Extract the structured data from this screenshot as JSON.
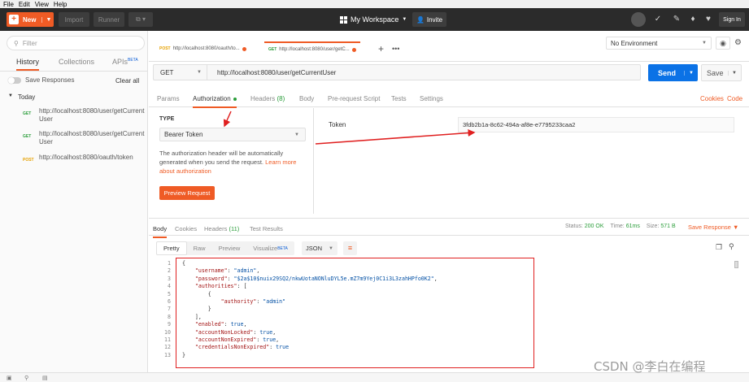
{
  "menu": [
    "File",
    "Edit",
    "View",
    "Help"
  ],
  "topbar": {
    "new_label": "New",
    "import_label": "Import",
    "runner_label": "Runner",
    "workspace_label": "My Workspace",
    "invite_label": "Invite",
    "signin_label": "Sign In",
    "bg_color": "#2b2b2b",
    "accent": "#ef5b25"
  },
  "sidebar": {
    "filter_placeholder": "Filter",
    "tabs": [
      "History",
      "Collections",
      "APIs"
    ],
    "apis_badge": "BETA",
    "save_responses": "Save Responses",
    "clear_all": "Clear all",
    "group": "Today",
    "items": [
      {
        "method": "GET",
        "url": "http://localhost:8080/user/getCurrentUser"
      },
      {
        "method": "GET",
        "url": "http://localhost:8080/user/getCurrentUser"
      },
      {
        "method": "POST",
        "url": "http://localhost:8080/oauth/token"
      }
    ]
  },
  "request_tabs": [
    {
      "method": "POST",
      "label": "http://localhost:8080/oauth/to..."
    },
    {
      "method": "GET",
      "label": "http://localhost:8080/user/getC..."
    }
  ],
  "environment": "No Environment",
  "request": {
    "method": "GET",
    "url": "http://localhost:8080/user/getCurrentUser",
    "send_label": "Send",
    "save_label": "Save"
  },
  "config_tabs": {
    "params": "Params",
    "authorization": "Authorization",
    "headers": "Headers",
    "headers_count": "(8)",
    "body": "Body",
    "prerequest": "Pre-request Script",
    "tests": "Tests",
    "settings": "Settings",
    "cookies": "Cookies",
    "code": "Code"
  },
  "auth": {
    "type_label": "TYPE",
    "type_value": "Bearer Token",
    "description": "The authorization header will be automatically generated when you send the request.",
    "learn_more": "Learn more about authorization",
    "preview_label": "Preview Request",
    "token_label": "Token",
    "token_value": "3fdb2b1a-8c62-494a-af8e-e7795233caa2"
  },
  "response_tabs": {
    "body": "Body",
    "cookies": "Cookies",
    "headers": "Headers",
    "headers_count": "(11)",
    "test_results": "Test Results",
    "status_label": "Status:",
    "status_value": "200 OK",
    "time_label": "Time:",
    "time_value": "61ms",
    "size_label": "Size:",
    "size_value": "571 B",
    "save_response": "Save Response"
  },
  "format": {
    "pretty": "Pretty",
    "raw": "Raw",
    "preview": "Preview",
    "visualize": "Visualize",
    "visualize_badge": "BETA",
    "type": "JSON"
  },
  "response_lines": [
    "1",
    "2",
    "3",
    "4",
    "5",
    "6",
    "7",
    "8",
    "9",
    "10",
    "11",
    "12",
    "13"
  ],
  "response_json": {
    "username": "admin",
    "password": "$2a$10$nuix29SQ2/nkwUotaNONluDYL5e.mZ7m9Yej0C1i3L3zahHPfo0K2",
    "authority": "admin",
    "enabled": "true",
    "accountNonLocked": "true",
    "accountNonExpired": "true",
    "credentialsNonExpired": "true"
  },
  "watermark": "CSDN @李白在编程"
}
